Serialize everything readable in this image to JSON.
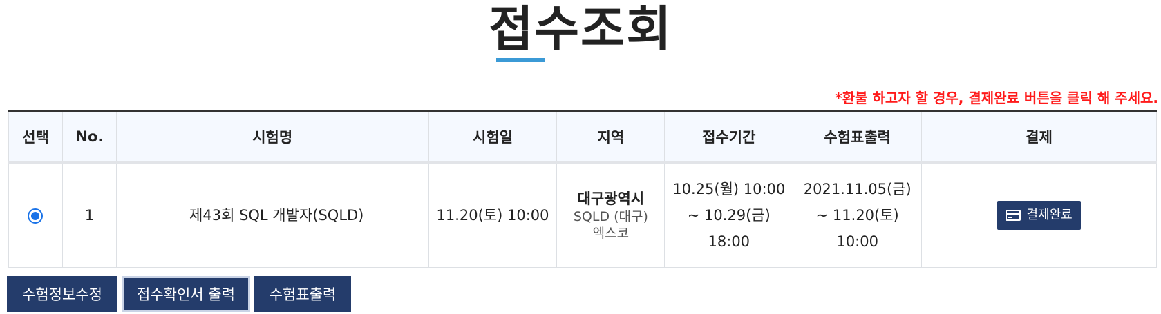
{
  "page": {
    "title": "접수조회"
  },
  "notice": "*환불 하고자 할 경우, 결제완료 버튼을 클릭 해 주세요.",
  "table": {
    "headers": [
      "선택",
      "No.",
      "시험명",
      "시험일",
      "지역",
      "접수기간",
      "수험표출력",
      "결제"
    ],
    "rows": [
      {
        "selected": true,
        "no": "1",
        "exam_name": "제43회 SQL 개발자(SQLD)",
        "exam_date": "11.20(토) 10:00",
        "region": {
          "name": "대구광역시",
          "sub1": "SQLD (대구)",
          "sub2": "엑스코"
        },
        "period": [
          "10.25(월) 10:00",
          "~ 10.29(금)",
          "18:00"
        ],
        "ticket": [
          "2021.11.05(금)",
          "~ 11.20(토)",
          "10:00"
        ],
        "payment_label": "결제완료"
      }
    ]
  },
  "buttons": {
    "edit_info": "수험정보수정",
    "print_confirmation": "접수확인서 출력",
    "print_ticket": "수험표출력"
  },
  "colors": {
    "accent": "#3b9ad6",
    "button_bg": "#243c6b",
    "notice": "#ff1a1a",
    "radio": "#1a73e8"
  },
  "icons": {
    "payment": "credit-card-icon"
  }
}
